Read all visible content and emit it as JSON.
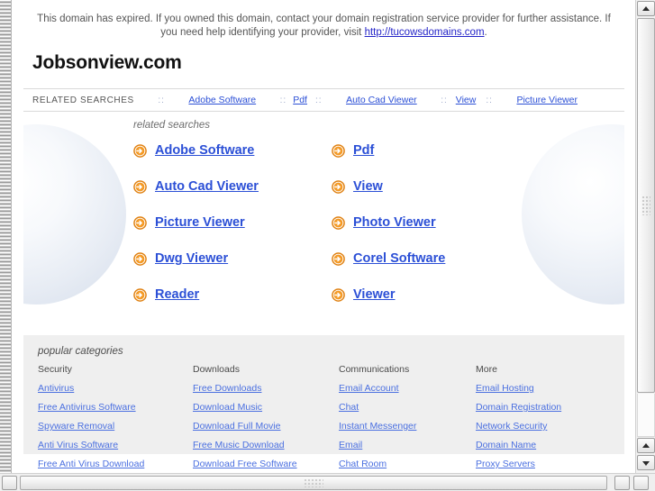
{
  "notice": {
    "text_before": "This domain has expired. If you owned this domain, contact your domain registration service provider for further assistance. If you need help identifying your provider, visit ",
    "link_text": "http://tucowsdomains.com",
    "text_after": "."
  },
  "brand": {
    "name": "Jobsonview.com"
  },
  "related_bar": {
    "label": "RELATED SEARCHES",
    "separator": "::",
    "links": [
      "Adobe Software",
      "Pdf",
      "Auto Cad Viewer",
      "View",
      "Picture Viewer"
    ]
  },
  "main": {
    "heading": "related searches",
    "links": [
      "Adobe Software",
      "Pdf",
      "Auto Cad Viewer",
      "View",
      "Picture Viewer",
      "Photo Viewer",
      "Dwg Viewer",
      "Corel Software",
      "Reader",
      "Viewer"
    ]
  },
  "categories": {
    "title": "popular categories",
    "columns": [
      {
        "heading": "Security",
        "items": [
          "Antivirus",
          "Free Antivirus Software",
          "Spyware Removal",
          "Anti Virus Software",
          "Free Anti Virus Download"
        ]
      },
      {
        "heading": "Downloads",
        "items": [
          "Free Downloads",
          "Download Music",
          "Download Full Movie",
          "Free Music Download",
          "Download Free Software"
        ]
      },
      {
        "heading": "Communications",
        "items": [
          "Email Account",
          "Chat",
          "Instant Messenger",
          "Email",
          "Chat Room"
        ]
      },
      {
        "heading": "More",
        "items": [
          "Email Hosting",
          "Domain Registration",
          "Network Security",
          "Domain Name",
          "Proxy Servers"
        ]
      }
    ]
  },
  "colors": {
    "link_blue": "#2b4fd6",
    "arrow_orange": "#f08a1c",
    "category_bg": "#efefef",
    "notice_gray": "#555555"
  },
  "icons": {
    "arrow_circle": "arrow-circle-right-icon"
  }
}
